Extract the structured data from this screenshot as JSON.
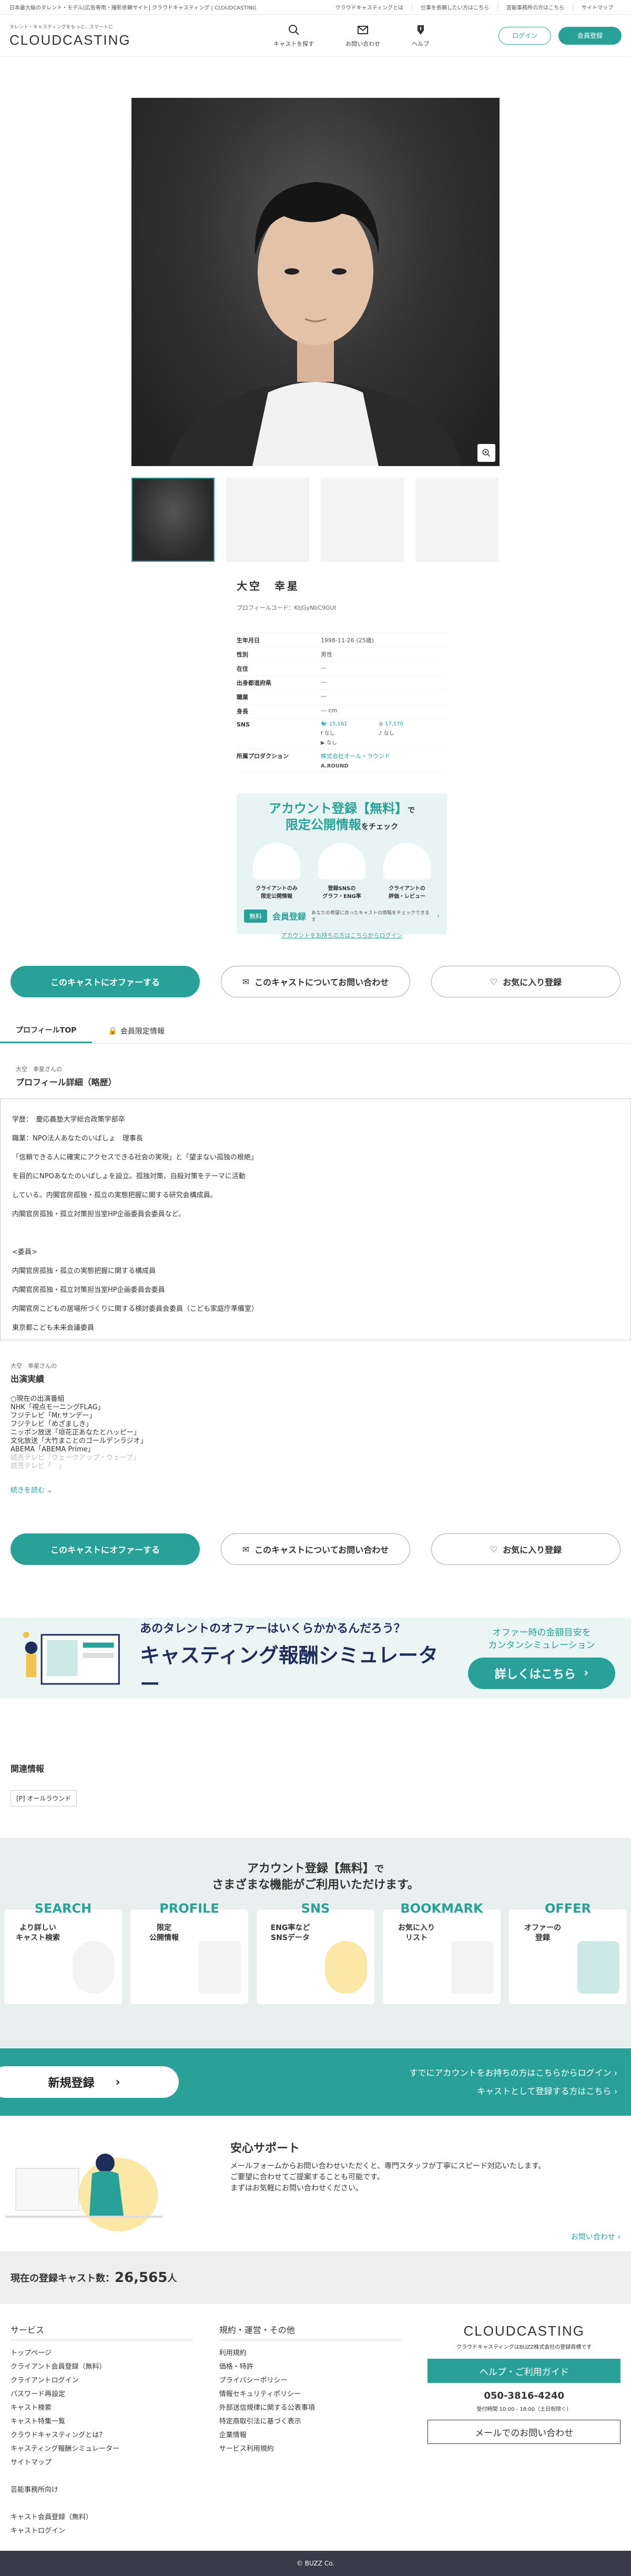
{
  "topbar": {
    "tagline": "日本最大級のタレント・モデル[広告専用・撮影依頼サイト] クラウドキャスティング | CLOUDCASTING",
    "links": [
      "クラウドキャスティングとは",
      "仕事を依頼したい方はこちら",
      "芸能事務所の方はこちら",
      "サイトマップ"
    ]
  },
  "header": {
    "logo_sub": "タレント・キャスティングをもっと、スマートに",
    "logo": "CLOUDCASTING",
    "nav": [
      {
        "label": "キャストを探す",
        "icon": "search-icon"
      },
      {
        "label": "お問い合わせ",
        "icon": "mail-icon"
      },
      {
        "label": "ヘルプ",
        "icon": "help-icon"
      }
    ],
    "login": "ログイン",
    "register": "会員登録"
  },
  "profile": {
    "name": "大空　幸星",
    "code": "プロフィールコード：KtjGyNbC9GUI",
    "rows": [
      {
        "k": "生年月日",
        "v": "1998-11-26 (25歳)"
      },
      {
        "k": "性別",
        "v": "男性"
      },
      {
        "k": "在住",
        "v": "—"
      },
      {
        "k": "出身都道府県",
        "v": "—"
      },
      {
        "k": "職業",
        "v": "—"
      },
      {
        "k": "身長",
        "v": "— cm"
      }
    ],
    "sns_label": "SNS",
    "sns": [
      {
        "name": "Twitter",
        "value": "15,161"
      },
      {
        "name": "Instagram",
        "value": "17,170"
      },
      {
        "name": "Facebook",
        "value": "なし"
      },
      {
        "name": "TikTok",
        "value": "なし"
      },
      {
        "name": "YouTube",
        "value": "なし"
      }
    ],
    "agency_label": "所属プロダクション",
    "agency": "株式会社オール・ラウンド",
    "agency_logo": "A.ROUND"
  },
  "promo": {
    "title_1": "アカウント登録【無料】",
    "title_suffix": "で",
    "title_2": "限定公開情報",
    "title_tail": "をチェック",
    "cards": [
      "クライアントのみ\n限定公開情報",
      "登録SNSの\nグラフ・ENG率",
      "クライアントの\n評価・レビュー"
    ],
    "badge": "無料",
    "bold": "会員登録",
    "note": "あなたの希望に合ったキャストの情報をチェックできます",
    "link": "アカウントをお持ちの方はこちらからログイン"
  },
  "actions": {
    "offer": "このキャストにオファーする",
    "inquiry": "このキャストについてお問い合わせ",
    "favorite": "お気に入り登録"
  },
  "tabs": [
    "プロフィールTOP",
    "会員限定情報"
  ],
  "detail": {
    "small": "大空　幸星さんの",
    "title": "プロフィール詳細（略歴）",
    "lines": [
      "学歴：　慶応義塾大学総合政策学部卒",
      "職業：NPO法人あなたのいばしょ　理事長",
      "「信頼できる人に確実にアクセスできる社会の実現」と「望まない孤独の根絶」",
      "を目的にNPOあなたのいばしょを設立。孤独対策、自殺対策をテーマに活動",
      "している。内閣官房孤独・孤立の実態把握に関する研究会構成員。",
      "内閣官房孤独・孤立対策担当室HP企画委員会委員など。",
      "",
      "<委員>",
      "内閣官房孤独・孤立の実態把握に関する構成員",
      "内閣官房孤独・孤立対策担当室HP企画委員会委員",
      "内閣官房こどもの居場所づくりに関する検討委員会委員（こども家庭庁準備室）",
      "東京都こども未来会議委員"
    ]
  },
  "works": {
    "small": "大空　幸星さんの",
    "title": "出演実績",
    "lines": [
      "○現在の出演番組",
      "NHK「視点モーニングFLAG」",
      "フジテレビ「Mr.サンデー」",
      "フジテレビ「めざましき」",
      "ニッポン放送「垣花正あなたとハッピー」",
      "文化放送「大竹まことのゴールデンラジオ」",
      "ABEMA「ABEMA Prime」",
      "読売テレビ「ウェークアップ・ウェーブ」",
      "読売テレビ「　」"
    ],
    "more": "続きを読む"
  },
  "simulator": {
    "line1": "あのタレントのオファーはいくらかかるんだろう？",
    "line2": "キャスティング報酬シミュレーター",
    "right_text": "オファー時の金額目安を\nカンタンシミュレーション",
    "button": "詳しくはこちら"
  },
  "related": {
    "title": "関連情報",
    "tag": "[P] オールラウンド"
  },
  "features": {
    "title_1": "アカウント登録【無料】",
    "title_suffix": "で",
    "title_2": "さまざまな機能がご利用いただけます。",
    "cards": [
      {
        "en": "SEARCH",
        "jp": "より詳しい\nキャスト検索"
      },
      {
        "en": "PROFILE",
        "jp": "限定\n公開情報"
      },
      {
        "en": "SNS",
        "jp": "ENG率など\nSNSデータ"
      },
      {
        "en": "BOOKMARK",
        "jp": "お気に入り\nリスト"
      },
      {
        "en": "OFFER",
        "jp": "オファーの\n登録"
      }
    ]
  },
  "signup": {
    "button": "新規登録",
    "link1": "すでにアカウントをお持ちの方はこちらからログイン",
    "link2": "キャストとして登録する方はこちら"
  },
  "support": {
    "title": "安心サポート",
    "text1": "メールフォームからお問い合わせいただくと、専門スタッフが丁寧にスピード対応いたします。",
    "text2": "ご要望に合わせてご提案することも可能です。",
    "text3": "まずはお気軽にお問い合わせください。",
    "link": "お問い合わせ"
  },
  "count": {
    "label": "現在の登録キャスト数：",
    "value": "26,565",
    "unit": "人"
  },
  "footer": {
    "col1_title": "サービス",
    "col1": [
      "トップページ",
      "クライアント会員登録（無料）",
      "クライアントログイン",
      "パスワード再設定",
      "キャスト検索",
      "キャスト特集一覧",
      "クラウドキャスティングとは？",
      "キャスティング報酬シミュレーター",
      "サイトマップ",
      "",
      "芸能事務所向け",
      "",
      "キャスト会員登録（無料）",
      "キャストログイン"
    ],
    "col2_title": "規約・運営・その他",
    "col2": [
      "利用規約",
      "価格・特許",
      "プライバシーポリシー",
      "情報セキュリティポリシー",
      "外部送信規律に関する公表事項",
      "特定商取引法に基づく表示",
      "企業情報",
      "サービス利用規約"
    ],
    "logo": "CLOUDCASTING",
    "desc": "クラウドキャスティングはBUZZ株式会社の登録商標です",
    "help": "ヘルプ・ご利用ガイド",
    "tel": "050-3816-4240",
    "hours": "受付時間 10:00 - 18:00（土日祝除く）",
    "mail": "メールでのお問い合わせ",
    "copy": "© BUZZ Co."
  },
  "colors": {
    "accent": "#2aa198",
    "navy": "#1f2d5c"
  }
}
